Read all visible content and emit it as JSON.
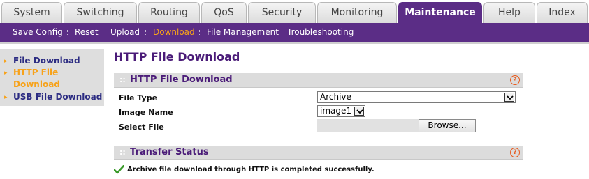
{
  "tabs": [
    {
      "label": "System",
      "active": false
    },
    {
      "label": "Switching",
      "active": false
    },
    {
      "label": "Routing",
      "active": false
    },
    {
      "label": "QoS",
      "active": false
    },
    {
      "label": "Security",
      "active": false
    },
    {
      "label": "Monitoring",
      "active": false
    },
    {
      "label": "Maintenance",
      "active": true
    },
    {
      "label": "Help",
      "active": false
    },
    {
      "label": "Index",
      "active": false
    }
  ],
  "subnav": [
    {
      "label": "Save Config",
      "active": false
    },
    {
      "label": "Reset",
      "active": false
    },
    {
      "label": "Upload",
      "active": false
    },
    {
      "label": "Download",
      "active": true
    },
    {
      "label": "File Management",
      "active": false
    },
    {
      "label": "Troubleshooting",
      "active": false
    }
  ],
  "leftmenu": {
    "items": [
      {
        "label": "File Download",
        "active": false
      },
      {
        "label": "HTTP File\nDownload",
        "active": true
      },
      {
        "label": "USB File Download",
        "active": false
      }
    ]
  },
  "page": {
    "title": "HTTP File Download"
  },
  "panels": {
    "download": {
      "title": "HTTP File Download",
      "grip": "::",
      "help": "?",
      "file_type_label": "File Type",
      "file_type_value": "Archive",
      "image_name_label": "Image Name",
      "image_name_value": "image1",
      "select_file_label": "Select File",
      "browse_label": "Browse..."
    },
    "status": {
      "title": "Transfer Status",
      "grip": "::",
      "help": "?",
      "message": "Archive file download through HTTP is completed successfully."
    }
  },
  "colors": {
    "brand_purple": "#5b2d86",
    "active_orange": "#f7a21a",
    "help_orange": "#e85a1c",
    "success_green": "#3a9a2a"
  }
}
